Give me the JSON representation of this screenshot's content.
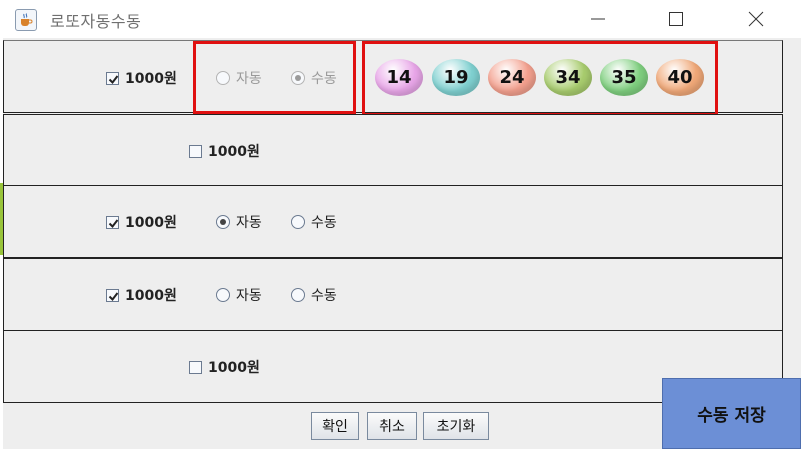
{
  "window": {
    "title": "로또자동수동",
    "icon": "java-cup-icon",
    "controls": [
      "minimize-icon",
      "maximize-icon",
      "close-icon"
    ]
  },
  "rows": [
    {
      "checkbox_label": "1000원",
      "checked": true,
      "radio_auto": "자동",
      "radio_manual": "수동",
      "selected": "manual",
      "radios_enabled": false,
      "numbers": [
        "14",
        "19",
        "24",
        "34",
        "35",
        "40"
      ]
    },
    {
      "checkbox_label": "1000원",
      "checked": false
    },
    {
      "checkbox_label": "1000원",
      "checked": true,
      "radio_auto": "자동",
      "radio_manual": "수동",
      "selected": "auto",
      "radios_enabled": true
    },
    {
      "checkbox_label": "1000원",
      "checked": true,
      "radio_auto": "자동",
      "radio_manual": "수동",
      "selected": "none",
      "radios_enabled": true
    },
    {
      "checkbox_label": "1000원",
      "checked": false
    }
  ],
  "ball_colors": [
    "#e8a6e8",
    "#7fd0d0",
    "#f3a08e",
    "#a8cc6e",
    "#7fcf7f",
    "#f0a878"
  ],
  "buttons": {
    "confirm": "확인",
    "cancel": "취소",
    "reset": "초기화"
  },
  "overlay": {
    "label": "수동 저장",
    "color": "#6c8fd6"
  },
  "highlight_color": "#e01010"
}
